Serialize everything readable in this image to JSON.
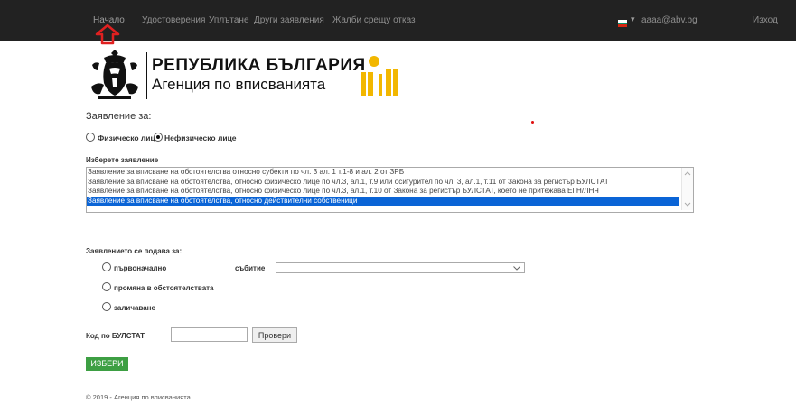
{
  "nav": {
    "items": [
      "Начало",
      "Удостоверения",
      "Уплътане",
      "Други заявления",
      "Жалби срещу отказ"
    ],
    "user": "aaaa@abv.bg",
    "logout": "Изход"
  },
  "agency": {
    "title": "РЕПУБЛИКА БЪЛГАРИЯ",
    "subtitle": "Агенция по вписванията"
  },
  "form": {
    "statement_for": "Заявление за:",
    "person_physical": "Физическо лице",
    "person_nonphysical": "Нефизическо лице",
    "person_selected": "Нефизическо лице",
    "choose_statement": "Изберете заявление",
    "options": [
      "Заявление за вписване на обстоятелства относно субекти по чл. 3 ал. 1 т.1-8 и ал. 2 от ЗРБ",
      "Заявление за вписване на обстоятелства, относно физическо лице по чл.3, ал.1, т.9 или осигурител по чл. 3, ал.1, т.11 от Закона за регистър БУЛСТАТ",
      "Заявление за вписване на обстоятелства, относно физическо лице по чл.3, ал.1, т.10 от Закона за регистър БУЛСТАТ, което не притежава ЕГН/ЛНЧ",
      "Заявление за вписване на обстоятелства, относно действителни собственици"
    ],
    "selected_option": "Заявление за вписване на обстоятелства, относно действителни собственици",
    "submitted_for": "Заявлението се подава за:",
    "initial": "първоначално",
    "event_label": "събитие",
    "change": "промяна в обстоятелствата",
    "delete": "заличаване",
    "bulstat_label": "Код по БУЛСТАТ",
    "bulstat_value": "",
    "check_button": "Провери",
    "choose_button": "ИЗБЕРИ"
  },
  "footer": "© 2019 - Агенция по вписванията",
  "colors": {
    "navbar": "#222222",
    "selection": "#0a64d6",
    "button_green": "#3d9f43",
    "mark_yellow": "#f2b700",
    "arrow_red": "#e02020"
  }
}
